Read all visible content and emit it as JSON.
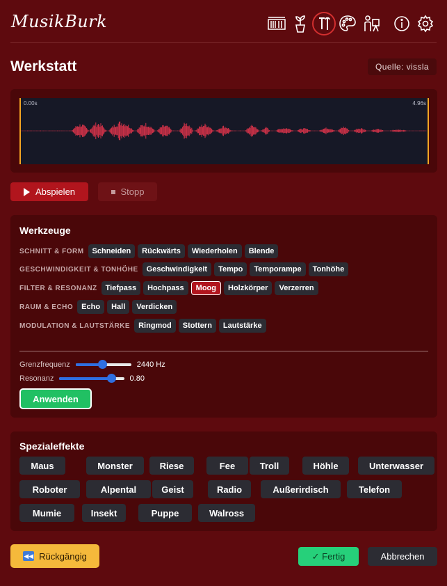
{
  "app": {
    "name": "MusikBurk"
  },
  "header": {
    "icons": [
      "library-icon",
      "plant-icon",
      "tools-icon",
      "palette-icon",
      "artist-icon",
      "info-icon",
      "settings-icon"
    ]
  },
  "page": {
    "title": "Werkstatt",
    "source": "Quelle: vissla"
  },
  "waveform": {
    "start_label": "0.00s",
    "end_label": "4.96s",
    "duration_s": 4.96
  },
  "transport": {
    "play_label": "Abspielen",
    "stop_label": "Stopp"
  },
  "tools": {
    "title": "Werkzeuge",
    "categories": [
      {
        "name": "SCHNITT & FORM",
        "items": [
          "Schneiden",
          "Rückwärts",
          "Wiederholen",
          "Blende"
        ]
      },
      {
        "name": "GESCHWINDIGKEIT & TONHÖHE",
        "items": [
          "Geschwindigkeit",
          "Tempo",
          "Temporampe",
          "Tonhöhe"
        ]
      },
      {
        "name": "FILTER & RESONANZ",
        "items": [
          "Tiefpass",
          "Hochpass",
          "Moog",
          "Holzkörper",
          "Verzerren"
        ]
      },
      {
        "name": "RAUM & ECHO",
        "items": [
          "Echo",
          "Hall",
          "Verdicken"
        ]
      },
      {
        "name": "MODULATION & LAUTSTÄRKE",
        "items": [
          "Ringmod",
          "Stottern",
          "Lautstärke"
        ]
      }
    ],
    "selected": "Moog",
    "params": {
      "cutoff": {
        "label": "Grenzfrequenz",
        "value": "2440 Hz",
        "fraction": 0.48
      },
      "resonance": {
        "label": "Resonanz",
        "value": "0.80",
        "fraction": 0.8
      }
    },
    "apply_label": "Anwenden"
  },
  "effects": {
    "title": "Spezialeffekte",
    "items": [
      "Maus",
      "Monster",
      "Riese",
      "Fee",
      "Troll",
      "Höhle",
      "Unterwasser",
      "Roboter",
      "Alpental",
      "Geist",
      "Radio",
      "Außerirdisch",
      "Telefon",
      "Mumie",
      "Insekt",
      "Puppe",
      "Walross"
    ]
  },
  "footer": {
    "undo_label": "Rückgängig",
    "undo_icon": "rewind-icon",
    "done_label": "✓  Fertig",
    "cancel_label": "Abbrechen"
  },
  "colors": {
    "accent": "#b1151d",
    "background": "#5e0a0e",
    "panel": "#4a0709",
    "wave": "#d8334a",
    "apply": "#21c063",
    "undo": "#f5b93b"
  }
}
